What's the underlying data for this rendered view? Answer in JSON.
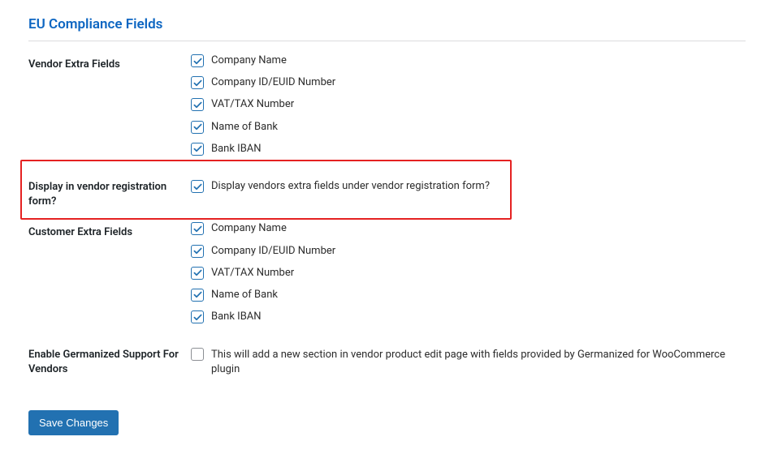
{
  "section_title": "EU Compliance Fields",
  "rows": {
    "vendor_extra": {
      "label": "Vendor Extra Fields",
      "options": [
        {
          "label": "Company Name",
          "checked": true
        },
        {
          "label": "Company ID/EUID Number",
          "checked": true
        },
        {
          "label": "VAT/TAX Number",
          "checked": true
        },
        {
          "label": "Name of Bank",
          "checked": true
        },
        {
          "label": "Bank IBAN",
          "checked": true
        }
      ]
    },
    "display_vendor_reg": {
      "label": "Display in vendor registration form?",
      "option": {
        "label": "Display vendors extra fields under vendor registration form?",
        "checked": true
      }
    },
    "customer_extra": {
      "label": "Customer Extra Fields",
      "options": [
        {
          "label": "Company Name",
          "checked": true
        },
        {
          "label": "Company ID/EUID Number",
          "checked": true
        },
        {
          "label": "VAT/TAX Number",
          "checked": true
        },
        {
          "label": "Name of Bank",
          "checked": true
        },
        {
          "label": "Bank IBAN",
          "checked": true
        }
      ]
    },
    "germanized": {
      "label": "Enable Germanized Support For Vendors",
      "option": {
        "label": "This will add a new section in vendor product edit page with fields provided by Germanized for WooCommerce plugin",
        "checked": false
      }
    }
  },
  "save_button_label": "Save Changes"
}
